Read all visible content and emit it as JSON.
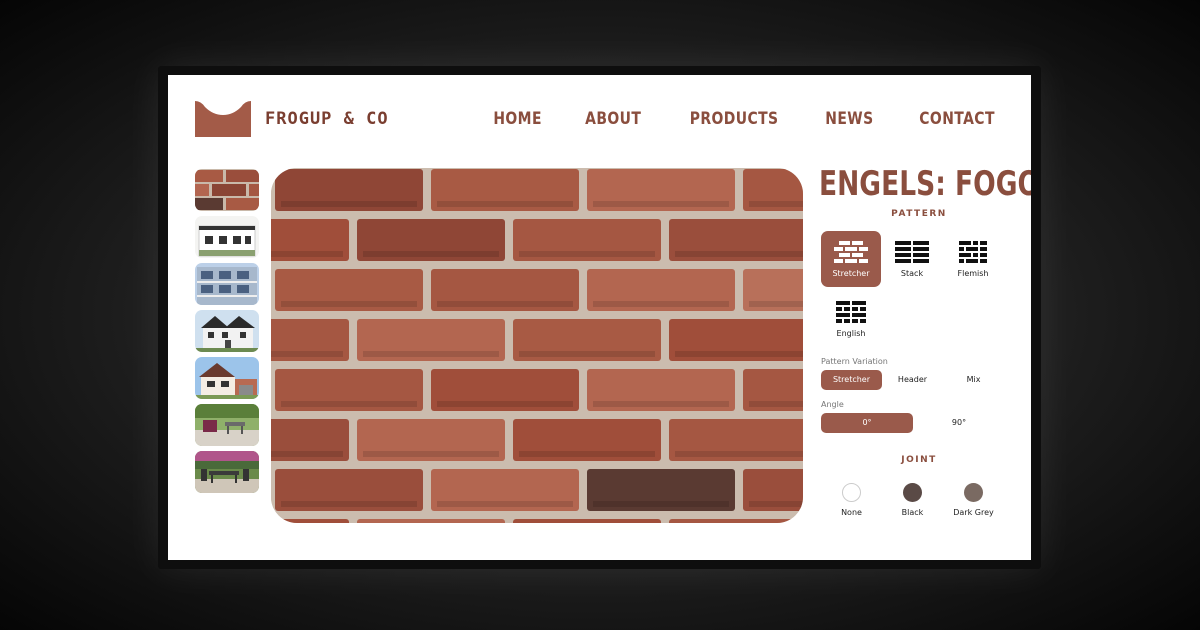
{
  "brand": {
    "name": "FROGUP & CO"
  },
  "nav": [
    "HOME",
    "ABOUT",
    "PRODUCTS",
    "NEWS",
    "CONTACT"
  ],
  "colors": {
    "accent": "#9a5a4b",
    "text_brown": "#8a4e3e",
    "brick": "#a85a44"
  },
  "product": {
    "title": "ENGELS: FOGO"
  },
  "pattern": {
    "heading": "PATTERN",
    "options": [
      "Stretcher",
      "Stack",
      "Flemish",
      "English"
    ],
    "selected": "Stretcher"
  },
  "pattern_variation": {
    "label": "Pattern Variation",
    "options": [
      "Stretcher",
      "Header",
      "Mix"
    ],
    "selected": "Stretcher"
  },
  "angle": {
    "label": "Angle",
    "options": [
      "0°",
      "90°"
    ],
    "selected": "0°"
  },
  "joint": {
    "heading": "JOINT",
    "options": [
      {
        "label": "None",
        "color": "#ffffff"
      },
      {
        "label": "Black",
        "color": "#5a4a46"
      },
      {
        "label": "Dark Grey",
        "color": "#7a6a62"
      }
    ]
  },
  "thumbnails": [
    "brick-texture",
    "white-building",
    "apartment-block",
    "white-house",
    "tudor-house",
    "patio",
    "garden-dining"
  ]
}
